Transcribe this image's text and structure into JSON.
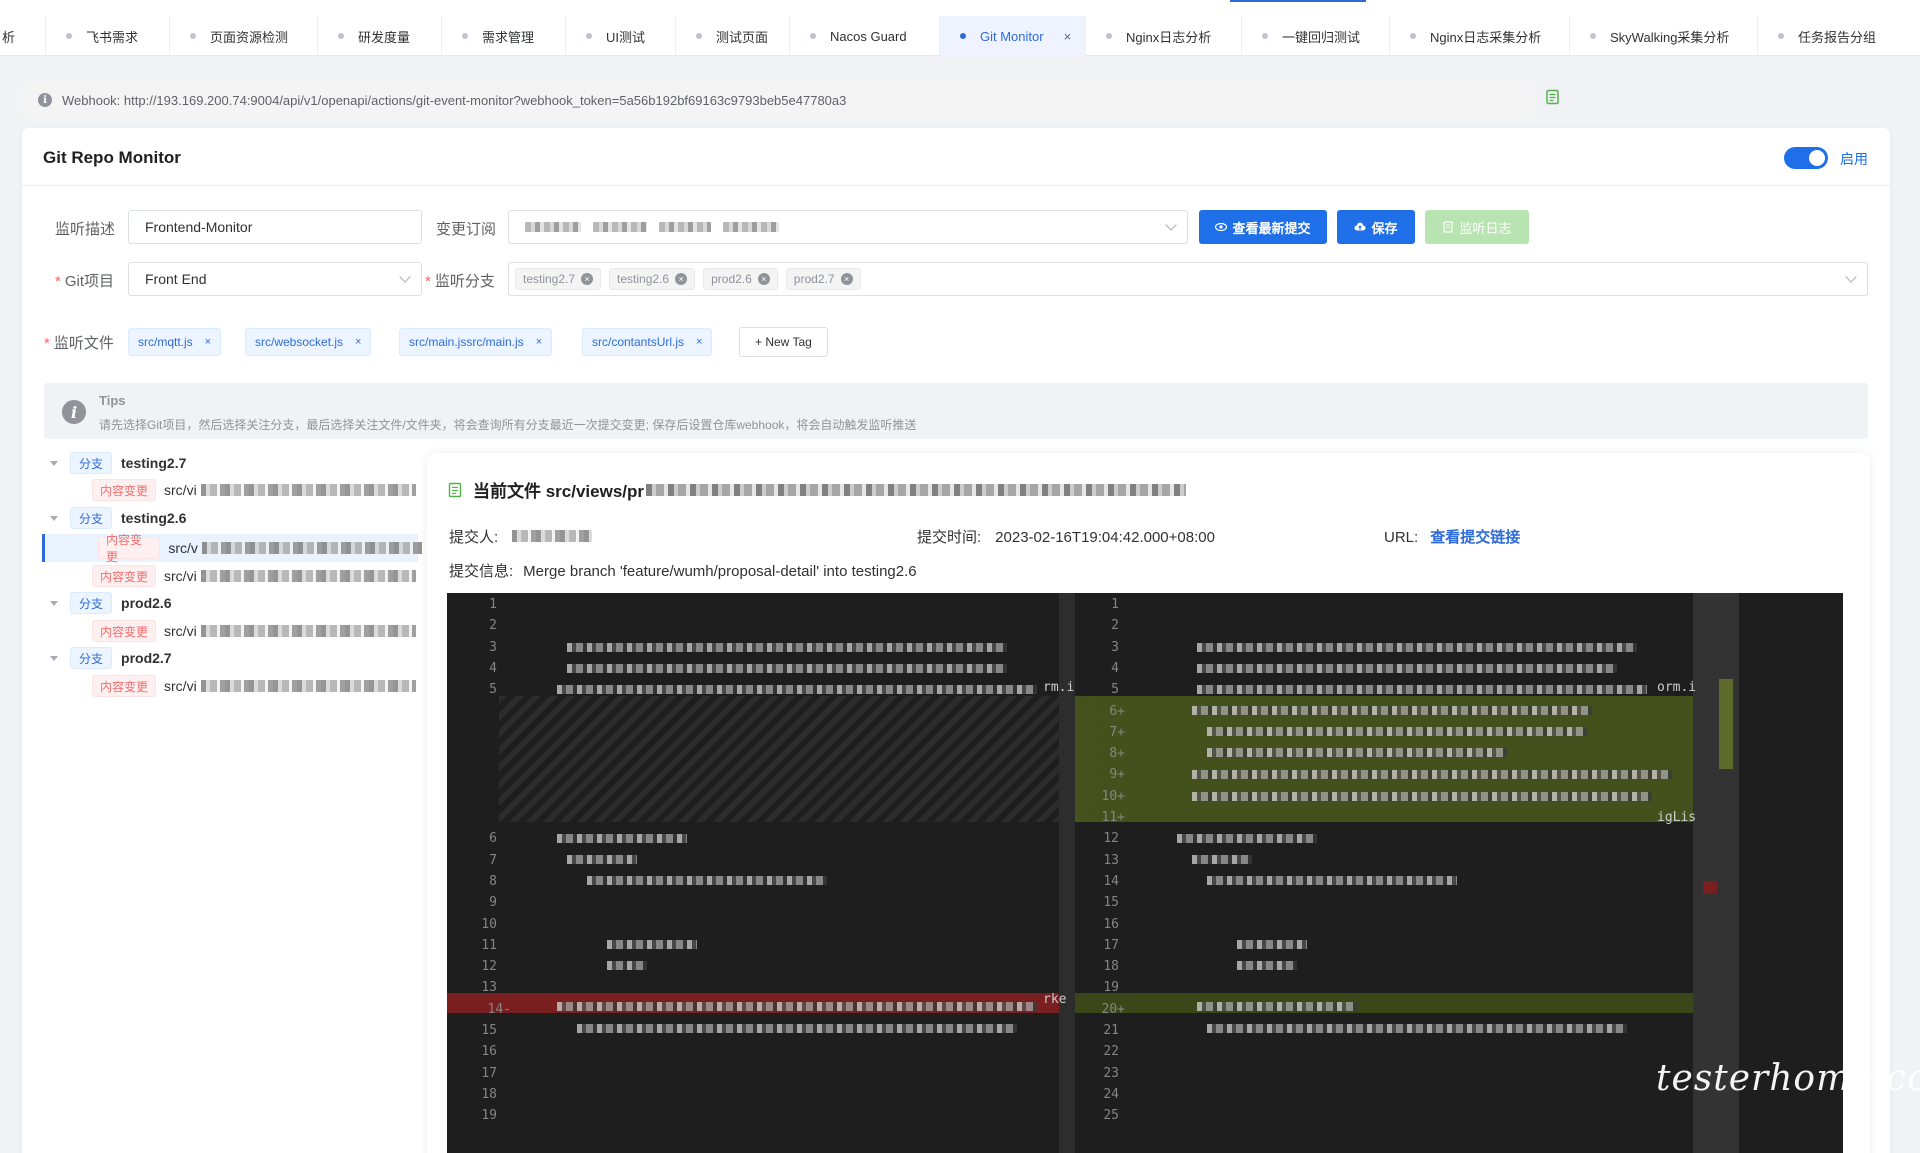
{
  "tabs": [
    {
      "label": "析",
      "active": false
    },
    {
      "label": "飞书需求",
      "active": false
    },
    {
      "label": "页面资源检测",
      "active": false
    },
    {
      "label": "研发度量",
      "active": false
    },
    {
      "label": "需求管理",
      "active": false
    },
    {
      "label": "UI测试",
      "active": false
    },
    {
      "label": "测试页面",
      "active": false
    },
    {
      "label": "Nacos Guard",
      "active": false
    },
    {
      "label": "Git Monitor",
      "active": true
    },
    {
      "label": "Nginx日志分析",
      "active": false
    },
    {
      "label": "一键回归测试",
      "active": false
    },
    {
      "label": "Nginx日志采集分析",
      "active": false
    },
    {
      "label": "SkyWalking采集分析",
      "active": false
    },
    {
      "label": "任务报告分组",
      "active": false
    }
  ],
  "webhook": {
    "text": "Webhook: http://193.169.200.74:9004/api/v1/openapi/actions/git-event-monitor?webhook_token=5a56b192bf69163c9793beb5e47780a3"
  },
  "card": {
    "title": "Git Repo Monitor",
    "enabled_label": "启用",
    "enabled": true
  },
  "form": {
    "desc_label": "监听描述",
    "desc_value": "Frontend-Monitor",
    "subscribe_label": "变更订阅",
    "project_label": "Git项目",
    "project_value": "Front End",
    "branch_label": "监听分支",
    "branches": [
      "testing2.7",
      "testing2.6",
      "prod2.6",
      "prod2.7"
    ],
    "file_label": "监听文件",
    "files": [
      "src/mqtt.js",
      "src/websocket.js",
      "src/main.jssrc/main.js",
      "src/contantsUrl.js"
    ],
    "new_tag": "+ New Tag"
  },
  "buttons": {
    "latest_commit": "查看最新提交",
    "save": "保存",
    "monitor_log": "监听日志"
  },
  "tips": {
    "title": "Tips",
    "text": "请先选择Git项目，然后选择关注分支，最后选择关注文件/文件夹，将会查询所有分支最近一次提交变更; 保存后设置仓库webhook，将会自动触发监听推送"
  },
  "tree": {
    "branch_badge": "分支",
    "change_badge": "内容变更",
    "nodes": [
      {
        "branch": "testing2.7",
        "files": [
          "src/vi"
        ]
      },
      {
        "branch": "testing2.6",
        "files": [
          "src/v",
          "src/vi"
        ]
      },
      {
        "branch": "prod2.6",
        "files": [
          "src/vi"
        ]
      },
      {
        "branch": "prod2.7",
        "files": [
          "src/vi"
        ]
      }
    ]
  },
  "detail": {
    "current_file_label": "当前文件 src/views/pr",
    "committer_label": "提交人:",
    "commit_time_label": "提交时间:",
    "commit_time": "2023-02-16T19:04:42.000+08:00",
    "url_label": "URL:",
    "url_link": "查看提交链接",
    "message_label": "提交信息:",
    "message": "Merge branch 'feature/wumh/proposal-detail' into testing2.6"
  },
  "diff": {
    "left_lines": [
      "1",
      "2",
      "3",
      "4",
      "5",
      "6",
      "7",
      "8",
      "9",
      "10",
      "11",
      "12",
      "13",
      "14-",
      "15",
      "16",
      "17",
      "18",
      "19"
    ],
    "right_lines": [
      "1",
      "2",
      "3",
      "4",
      "5",
      "6+",
      "7+",
      "8+",
      "9+",
      "10+",
      "11+",
      "12",
      "13",
      "14",
      "15",
      "16",
      "17",
      "18",
      "19",
      "20+",
      "21",
      "22",
      "23",
      "24",
      "25"
    ],
    "left_snippets": {
      "l5": "rm.i",
      "l14": "rke"
    },
    "right_snippets": {
      "r5": "orm.i",
      "r11": "igLis"
    }
  },
  "watermark": "testerhome.com",
  "colors": {
    "accent": "#2f6bd8",
    "switch": "#1e6fe8",
    "save_button": "#1e6fe8",
    "log_button": "#b7e4b0",
    "diff_added": "#4b5a1c",
    "diff_removed": "#7a1f1f",
    "editor_bg": "#1e1e1e"
  }
}
